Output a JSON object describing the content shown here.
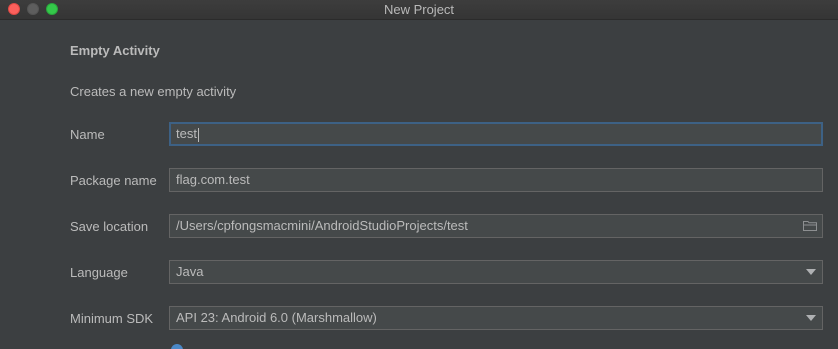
{
  "window": {
    "title": "New Project"
  },
  "template": {
    "heading": "Empty Activity",
    "description": "Creates a new empty activity"
  },
  "form": {
    "name": {
      "label": "Name",
      "value": "test"
    },
    "package": {
      "label": "Package name",
      "value": "flag.com.test"
    },
    "save_location": {
      "label": "Save location",
      "value": "/Users/cpfongsmacmini/AndroidStudioProjects/test",
      "icon": "folder-icon"
    },
    "language": {
      "label": "Language",
      "value": "Java",
      "icon": "chevron-down-icon"
    },
    "min_sdk": {
      "label": "Minimum SDK",
      "value": "API 23: Android 6.0 (Marshmallow)",
      "icon": "chevron-down-icon"
    }
  },
  "colors": {
    "background": "#3c3f41",
    "field_background": "#45494a",
    "focus_border": "#3d6185",
    "text": "#bbbbbb",
    "close": "#fc605c",
    "maximize": "#34c84a"
  }
}
